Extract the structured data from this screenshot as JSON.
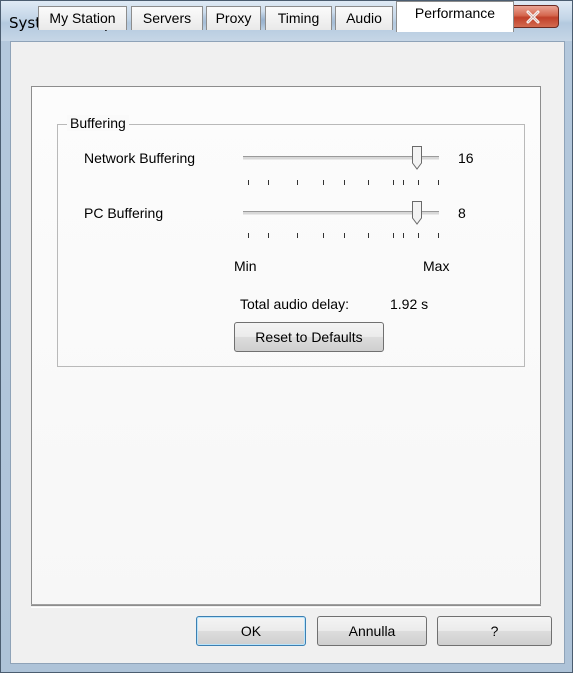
{
  "window": {
    "title": "System Setup",
    "close_icon": "close-x-icon"
  },
  "tabs": [
    {
      "label": "My Station",
      "active": false
    },
    {
      "label": "Servers",
      "active": false
    },
    {
      "label": "Proxy",
      "active": false
    },
    {
      "label": "Timing",
      "active": false
    },
    {
      "label": "Audio",
      "active": false
    },
    {
      "label": "Performance",
      "active": true
    }
  ],
  "buffering": {
    "group_label": "Buffering",
    "network": {
      "label": "Network Buffering",
      "value": "16",
      "level": 0.89
    },
    "pc": {
      "label": "PC Buffering",
      "value": "8",
      "level": 0.89
    },
    "min_label": "Min",
    "max_label": "Max",
    "delay_label": "Total audio delay:",
    "delay_value": "1.92 s",
    "reset_label": "Reset to Defaults"
  },
  "footer": {
    "ok_label": "OK",
    "cancel_label": "Annulla",
    "help_label": "?"
  }
}
